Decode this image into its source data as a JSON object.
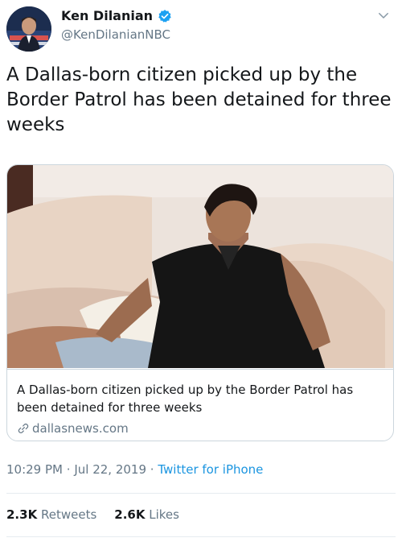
{
  "author": {
    "display_name": "Ken Dilanian",
    "handle": "@KenDilanianNBC",
    "verified": true
  },
  "tweet": {
    "text": "A Dallas-born citizen picked up by the Border Patrol has been detained for three weeks",
    "time": "10:29 PM",
    "separator": "·",
    "date": "Jul 22, 2019",
    "source": "Twitter for iPhone"
  },
  "card": {
    "title": "A Dallas-born citizen picked up by the Border Patrol has been detained for three weeks",
    "domain": "dallasnews.com"
  },
  "stats": {
    "retweets_count": "2.3K",
    "retweets_label": "Retweets",
    "likes_count": "2.6K",
    "likes_label": "Likes"
  },
  "icons": {
    "verified": "verified-badge-icon",
    "chevron": "chevron-down-icon",
    "link": "link-icon"
  },
  "colors": {
    "accent": "#1da1f2",
    "link": "#1b95e0",
    "secondary_text": "#657786",
    "border": "#ccd6dd"
  }
}
